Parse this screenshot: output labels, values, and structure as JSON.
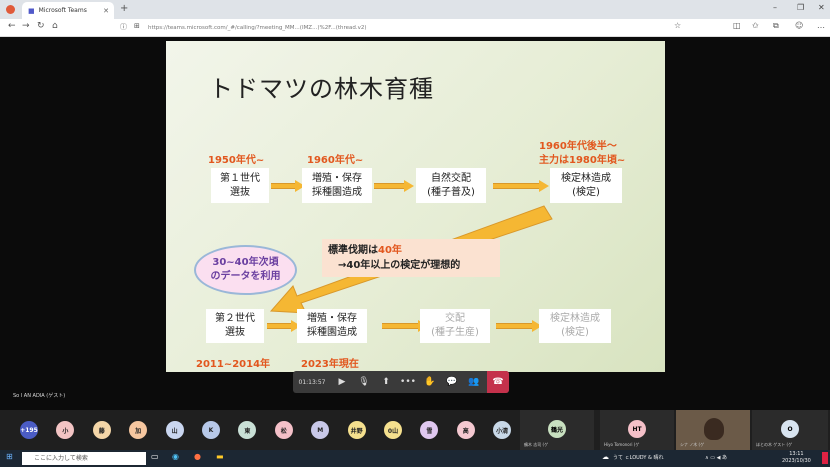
{
  "browser": {
    "tab_title": "Microsoft Teams",
    "url": "https://teams.microsoft.com/_#/calling/?meeting_MM...(IMZ...)%2F...(thread.v2)"
  },
  "slide": {
    "title": "トドマツの林木育種",
    "labels": {
      "l1950": "1950年代~",
      "l1960": "1960年代~",
      "l1960late_1": "1960年代後半～",
      "l1960late_2": "主力は1980年頃~",
      "l2011": "2011~2014年",
      "l2023": "2023年現在"
    },
    "boxes": {
      "gen1_1": "第１世代",
      "gen1_2": "選抜",
      "breed1_1": "増殖・保存",
      "breed1_2": "採種園造成",
      "cross1_1": "自然交配",
      "cross1_2": "(種子普及)",
      "test1_1": "検定林造成",
      "test1_2": "(検定)",
      "gen2_1": "第２世代",
      "gen2_2": "選抜",
      "breed2_1": "増殖・保存",
      "breed2_2": "採種園造成",
      "cross2_1": "交配",
      "cross2_2": "(種子生産)",
      "test2_1": "検定林造成",
      "test2_2": "(検定)"
    },
    "note_line1_a": "標準伐期は",
    "note_line1_b": "40年",
    "note_line2": "→40年以上の検定が理想的",
    "bubble_1": "30~40年次頃",
    "bubble_2": "のデータを利用"
  },
  "presenter_label": "So l AN ADIA (ゲスト)",
  "toolbar": {
    "timer": "01:13:57"
  },
  "participants": {
    "avatars": [
      {
        "label": "+195",
        "color": "#4b5cc4",
        "text_color": "#ffffff"
      },
      {
        "label": "小",
        "color": "#f2c4c4"
      },
      {
        "label": "藤",
        "color": "#f4d6a8"
      },
      {
        "label": "加",
        "color": "#f6c7a0"
      },
      {
        "label": "山",
        "color": "#c9d6f0"
      },
      {
        "label": "K",
        "color": "#b7c8e8"
      },
      {
        "label": "東",
        "color": "#c9e0d6"
      },
      {
        "label": "松",
        "color": "#f4c0c8"
      },
      {
        "label": "M",
        "color": "#c8c8e8"
      },
      {
        "label": "井野",
        "color": "#f5e08e"
      },
      {
        "label": "0山",
        "color": "#f5e08e"
      },
      {
        "label": "雪",
        "color": "#e0c8f0"
      },
      {
        "label": "高",
        "color": "#f4c8d0"
      },
      {
        "label": "小清",
        "color": "#c8d8e8"
      }
    ],
    "tiles": [
      {
        "initials": "鶴光",
        "color": "#c8e0c0",
        "name": "鶴木 志司 (ゲ"
      },
      {
        "initials": "HT",
        "color": "#f4c0c8",
        "name": "Hiyo Tomonori (ゲ"
      },
      {
        "initials": "",
        "color": "#444444",
        "name": "シナ ノ木 (ゲ"
      },
      {
        "initials": "O",
        "color": "#d8e4f0",
        "name": "ほとの木 ゲスト (ゲ"
      }
    ]
  },
  "taskbar": {
    "search_placeholder": "ここに入力して検索",
    "tray_text": "うて ｃLOUDY & 晴れ",
    "time": "13:11",
    "date": "2023/10/30"
  }
}
